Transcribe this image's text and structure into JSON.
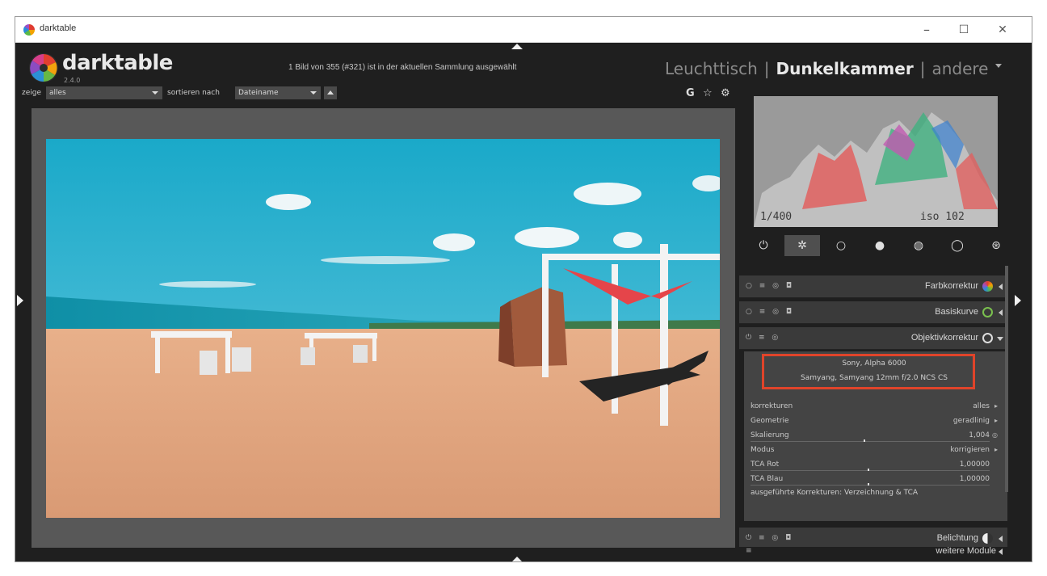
{
  "window": {
    "title": "darktable",
    "minimize": "–",
    "maximize": "☐",
    "close": "✕"
  },
  "header": {
    "logo_text": "darktable",
    "version": "2.4.0",
    "status": "1 Bild von 355 (#321) ist in der aktuellen Sammlung ausgewählt",
    "views": {
      "lighttable": "Leuchttisch",
      "separator": "|",
      "darkroom": "Dunkelkammer",
      "other": "andere"
    }
  },
  "filterbar": {
    "show_label": "zeige",
    "show_value": "alles",
    "sort_label": "sortieren nach",
    "sort_value": "Dateiname",
    "icons": {
      "g": "G",
      "star": "☆",
      "gear": "⚙"
    }
  },
  "histogram": {
    "exposure": "1/400",
    "iso": "iso 102"
  },
  "module_groups": [
    {
      "name": "power-icon",
      "glyph": "⏻"
    },
    {
      "name": "active-icon",
      "glyph": "✲"
    },
    {
      "name": "basic-icon",
      "glyph": "○"
    },
    {
      "name": "tone-icon",
      "glyph": "●"
    },
    {
      "name": "color-icon",
      "glyph": "◍"
    },
    {
      "name": "correct-icon",
      "glyph": "◯"
    },
    {
      "name": "effect-icon",
      "glyph": "⊛"
    }
  ],
  "modules": {
    "farbkorrektur": "Farbkorrektur",
    "basiskurve": "Basiskurve",
    "objektivkorrektur": "Objektivkorrektur",
    "belichtung": "Belichtung",
    "weitere": "weitere Module"
  },
  "lens": {
    "camera": "Sony, Alpha 6000",
    "lens": "Samyang, Samyang 12mm f/2.0 NCS CS",
    "rows": [
      {
        "key": "korrekturen",
        "value": "alles"
      },
      {
        "key": "Geometrie",
        "value": "geradlinig"
      },
      {
        "key": "Skalierung",
        "value": "1,004"
      },
      {
        "key": "Modus",
        "value": "korrigieren"
      },
      {
        "key": "TCA Rot",
        "value": "1,00000"
      },
      {
        "key": "TCA Blau",
        "value": "1,00000"
      }
    ],
    "summary": "ausgeführte Korrekturen: Verzeichnung & TCA"
  },
  "colors": {
    "highlight": "#e0442a",
    "panel_bg": "#1f1f1f",
    "center_bg": "#585858"
  }
}
